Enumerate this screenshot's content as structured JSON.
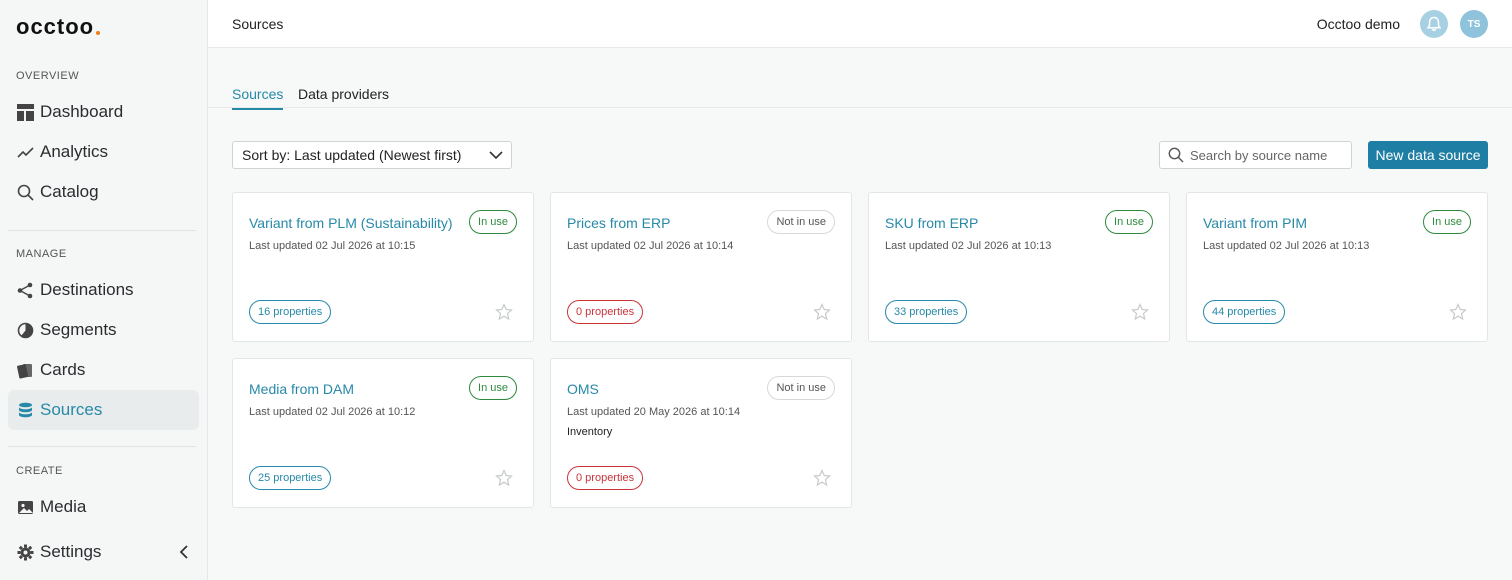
{
  "app": {
    "logo_text": "occtoo"
  },
  "sidebar": {
    "sections": [
      {
        "label": "OVERVIEW"
      },
      {
        "label": "MANAGE"
      },
      {
        "label": "CREATE"
      }
    ],
    "items": [
      {
        "label": "Dashboard",
        "icon": "dashboard-icon"
      },
      {
        "label": "Analytics",
        "icon": "analytics-icon"
      },
      {
        "label": "Catalog",
        "icon": "search-icon"
      },
      {
        "label": "Destinations",
        "icon": "share-icon"
      },
      {
        "label": "Segments",
        "icon": "pie-icon"
      },
      {
        "label": "Cards",
        "icon": "cards-icon"
      },
      {
        "label": "Sources",
        "icon": "database-icon",
        "active": true
      },
      {
        "label": "Media",
        "icon": "image-icon"
      },
      {
        "label": "Settings",
        "icon": "gear-icon"
      }
    ]
  },
  "header": {
    "title": "Sources",
    "org": "Occtoo demo",
    "avatar_initials": "TS"
  },
  "tabs": [
    {
      "label": "Sources",
      "active": true
    },
    {
      "label": "Data providers",
      "active": false
    }
  ],
  "toolbar": {
    "sort_label": "Sort by: Last updated (Newest first)",
    "search_placeholder": "Search by source name",
    "new_button": "New data source"
  },
  "cards": [
    {
      "title": "Variant from PLM (Sustainability)",
      "updated": "Last updated 02 Jul 2026 at 10:15",
      "status": "In use",
      "properties": "16 properties",
      "description": ""
    },
    {
      "title": "Prices from ERP",
      "updated": "Last updated 02 Jul 2026 at 10:14",
      "status": "Not in use",
      "properties": "0 properties",
      "description": ""
    },
    {
      "title": "SKU from ERP",
      "updated": "Last updated 02 Jul 2026 at 10:13",
      "status": "In use",
      "properties": "33 properties",
      "description": ""
    },
    {
      "title": "Variant from PIM",
      "updated": "Last updated 02 Jul 2026 at 10:13",
      "status": "In use",
      "properties": "44 properties",
      "description": ""
    },
    {
      "title": "Media from DAM",
      "updated": "Last updated 02 Jul 2026 at 10:12",
      "status": "In use",
      "properties": "25 properties",
      "description": ""
    },
    {
      "title": "OMS",
      "updated": "Last updated 20 May 2026 at 10:14",
      "status": "Not in use",
      "properties": "0 properties",
      "description": "Inventory"
    }
  ],
  "colors": {
    "accent": "#2789a8",
    "primary_button": "#1f7ea3",
    "in_use": "#2e8a3d",
    "zero_props": "#c9343b"
  }
}
